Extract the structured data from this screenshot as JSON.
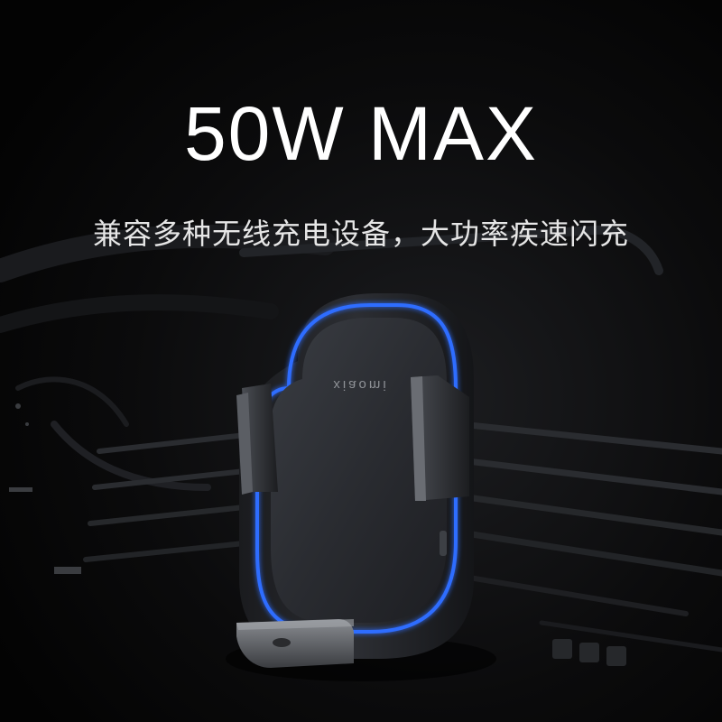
{
  "headline": "50W MAX",
  "subheadline": "兼容多种无线充电设备，大功率疾速闪充",
  "product": {
    "brand_mark": "xiaomi"
  },
  "colors": {
    "background": "#050505",
    "headline_text": "#ffffff",
    "subheadline_text": "#e6e6e6",
    "charger_glow": "#2f6dff",
    "charger_body": "#2a2c30"
  }
}
